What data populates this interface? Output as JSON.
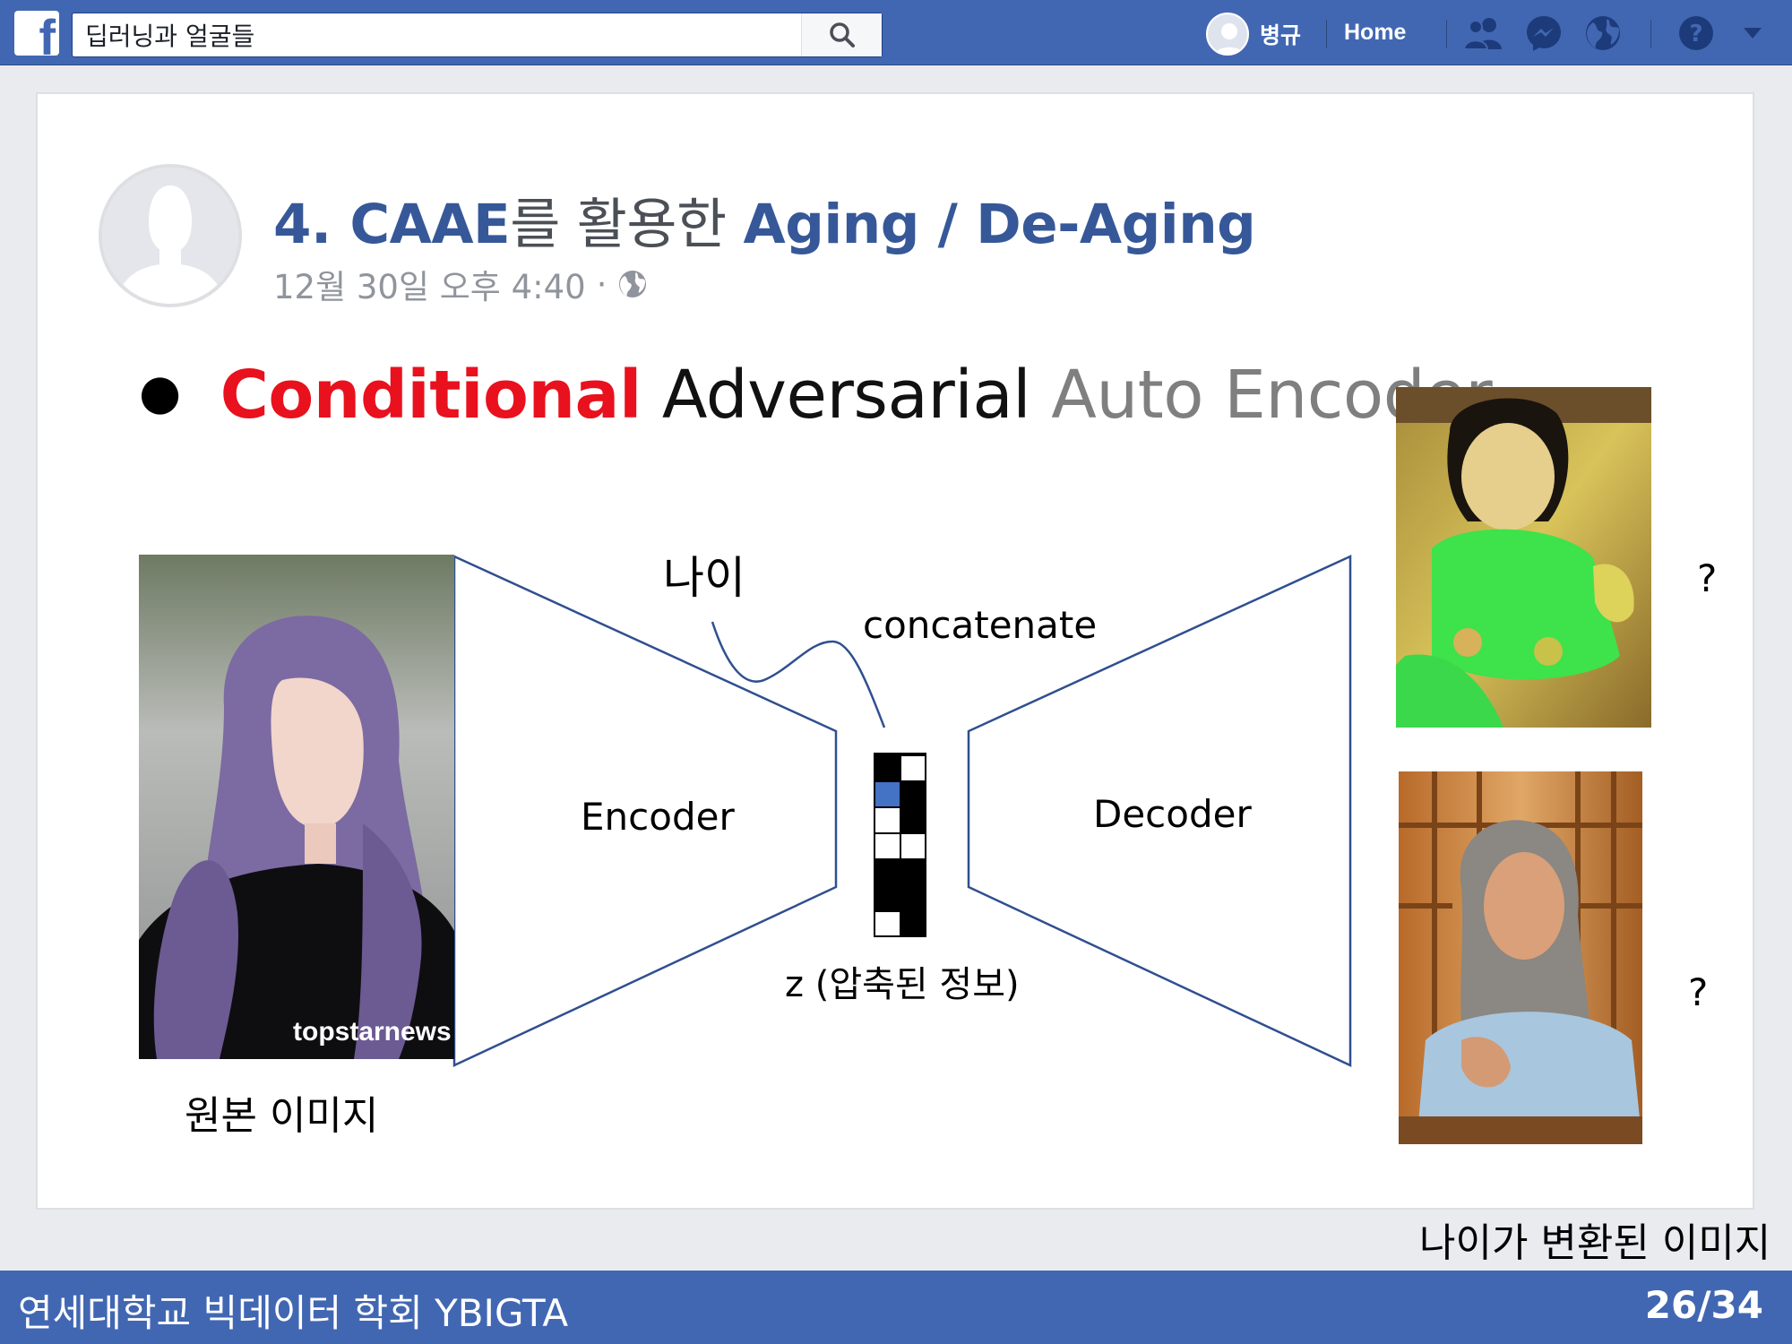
{
  "topbar": {
    "logo": "f",
    "search_value": "딥러닝과 얼굴들",
    "profile_name": "병규",
    "home_label": "Home",
    "icons": [
      "friends-icon",
      "messenger-icon",
      "globe-icon",
      "help-icon",
      "caret-down-icon"
    ],
    "help_glyph": "?"
  },
  "post": {
    "title_number": "4. CAAE",
    "title_korean": "를 활용한 ",
    "title_rest": "Aging / De-Aging",
    "timestamp": "12월 30일 오후 4:40",
    "meta_separator": "·"
  },
  "slide": {
    "bullet_word1": "Conditional",
    "bullet_word2": "Adversarial",
    "bullet_word3": "Auto Encoder",
    "label_age": "나이",
    "label_concat": "concatenate",
    "label_encoder": "Encoder",
    "label_decoder": "Decoder",
    "label_z": "z (압축된 정보)",
    "question_1": "?",
    "question_2": "?",
    "caption_source": "원본 이미지",
    "caption_result": "나이가 변환된 이미지",
    "watermark": "topstarnews"
  },
  "footer": {
    "org": "연세대학교 빅데이터 학회 YBIGTA",
    "page": "26/34"
  },
  "colors": {
    "facebook_blue": "#4267b2",
    "title_blue": "#365899",
    "bullet_red": "#e8111d",
    "latent_highlight": "#4472c4",
    "trapezoid_stroke": "#2f4f8f"
  }
}
